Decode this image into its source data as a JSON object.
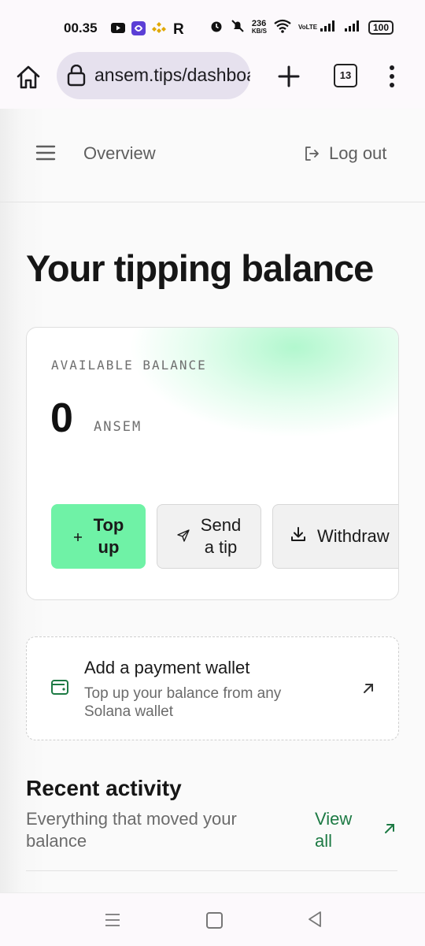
{
  "status_bar": {
    "time": "00.35",
    "network_speed": "236",
    "network_unit": "KB/S",
    "volte": "VoLTE",
    "battery": "100"
  },
  "browser": {
    "url": "ansem.tips/dashboard",
    "tab_count": "13"
  },
  "nav": {
    "title": "Overview",
    "logout_label": "Log out"
  },
  "page": {
    "title": "Your tipping balance"
  },
  "balance": {
    "label": "AVAILABLE BALANCE",
    "value": "0",
    "unit": "ANSEM",
    "topup_line1": "Top",
    "topup_line2": "up",
    "send_line1": "Send",
    "send_line2": "a tip",
    "withdraw_label": "Withdraw",
    "accent_color": "#6ff2a6"
  },
  "wallet": {
    "title": "Add a payment wallet",
    "description": "Top up your balance from any Solana wallet",
    "icon_color": "#1d7a44"
  },
  "activity": {
    "title": "Recent activity",
    "subtitle": "Everything that moved your balance",
    "view_all_line1": "View",
    "view_all_line2": "all",
    "link_color": "#1d7a44"
  }
}
